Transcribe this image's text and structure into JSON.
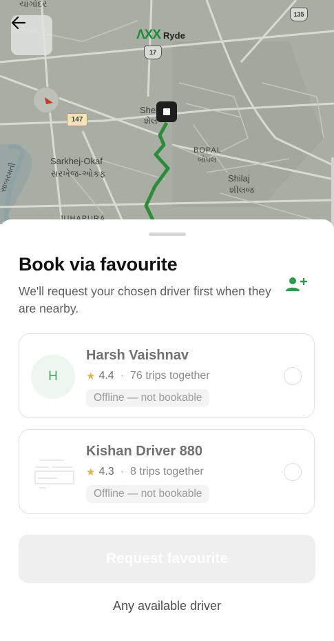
{
  "map": {
    "brand_name": "Ryde",
    "labels": [
      {
        "id": "top-left",
        "text": "ચાંગોદર"
      },
      {
        "id": "she",
        "text": "She"
      },
      {
        "id": "she-gu",
        "text": "શેલ"
      },
      {
        "id": "bopal",
        "text": "BOPAL"
      },
      {
        "id": "bopal-gu",
        "text": "બોપલ"
      },
      {
        "id": "sarkhej",
        "text": "Sarkhej-Okaf"
      },
      {
        "id": "sarkhej-gu",
        "text": "સરખેજ-ઓકફ"
      },
      {
        "id": "shilaj",
        "text": "Shilaj"
      },
      {
        "id": "shilaj-gu",
        "text": "શીલજ"
      },
      {
        "id": "juhapura",
        "text": "JUHAPURA"
      },
      {
        "id": "river",
        "text": "સાબરમતી"
      }
    ],
    "highway_135": "135",
    "highway_17": "17",
    "highway_147": "147",
    "route_color": "#2e8b3a",
    "map_color": "#a6aca1"
  },
  "sheet": {
    "title": "Book via favourite",
    "subtitle": "We'll request your chosen driver first when they are nearby.",
    "add_icon": "add-person-icon",
    "accent": "#2e9a4a"
  },
  "drivers": [
    {
      "initial": "H",
      "name": "Harsh Vaishnav",
      "rating": "4.4",
      "trips": "76 trips together",
      "status": "Offline — not bookable"
    },
    {
      "initial": "",
      "name": "Kishan Driver 880",
      "rating": "4.3",
      "trips": "8 trips together",
      "status": "Offline — not bookable"
    }
  ],
  "actions": {
    "request_label": "Request favourite",
    "any_driver_label": "Any available driver"
  }
}
